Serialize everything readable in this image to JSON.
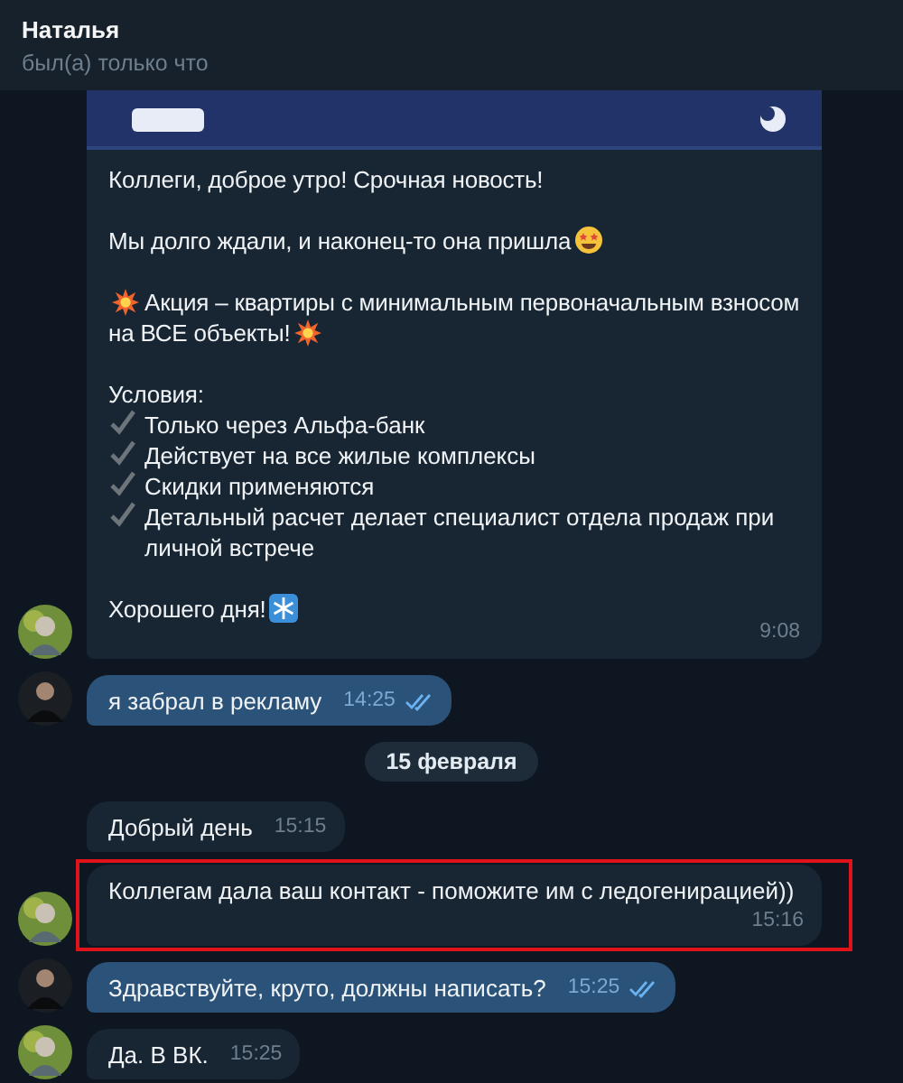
{
  "header": {
    "name": "Наталья",
    "status": "был(а) только что"
  },
  "messages": [
    {
      "kind": "incoming",
      "avatar": true,
      "highlighted": false,
      "time": "9:08",
      "blocks": [
        {
          "kind": "picture"
        },
        {
          "kind": "line",
          "parts": [
            {
              "kind": "text",
              "text": "Коллеги, доброе утро! Срочная новость!"
            }
          ]
        },
        {
          "kind": "gap"
        },
        {
          "kind": "line",
          "parts": [
            {
              "kind": "text",
              "text": "Мы долго ждали, и наконец-то она пришла"
            },
            {
              "kind": "starface"
            }
          ]
        },
        {
          "kind": "gap"
        },
        {
          "kind": "line",
          "parts": [
            {
              "kind": "burst"
            },
            {
              "kind": "text",
              "text": "Акция – квартиры с минимальным первоначальным взносом"
            }
          ]
        },
        {
          "kind": "line",
          "parts": [
            {
              "kind": "text",
              "text": "на ВСЕ объекты!"
            },
            {
              "kind": "burst"
            }
          ]
        },
        {
          "kind": "gap"
        },
        {
          "kind": "line",
          "parts": [
            {
              "kind": "text",
              "text": "Условия:"
            }
          ]
        },
        {
          "kind": "check",
          "text": "Только через Альфа-банк"
        },
        {
          "kind": "check",
          "text": "Действует на все жилые комплексы"
        },
        {
          "kind": "check",
          "text": "Скидки применяются"
        },
        {
          "kind": "check",
          "text": "Детальный расчет делает специалист отдела продаж при личной встрече"
        },
        {
          "kind": "gap"
        },
        {
          "kind": "line",
          "parts": [
            {
              "kind": "text",
              "text": "Хорошего дня!"
            },
            {
              "kind": "snowflake"
            }
          ]
        }
      ]
    },
    {
      "kind": "outgoing",
      "avatar": true,
      "highlighted": false,
      "read": true,
      "time": "14:25",
      "text": "я забрал в рекламу"
    },
    {
      "kind": "date",
      "text": "15 февраля"
    },
    {
      "kind": "incoming",
      "avatar": false,
      "highlighted": false,
      "time": "15:15",
      "text": "Добрый день"
    },
    {
      "kind": "incoming",
      "avatar": true,
      "highlighted": true,
      "time": "15:16",
      "text": "Коллегам дала ваш контакт - поможите им с ледогенирацией))"
    },
    {
      "kind": "outgoing",
      "avatar": true,
      "highlighted": false,
      "read": true,
      "time": "15:25",
      "text": "Здравствуйте, круто, должны написать?"
    },
    {
      "kind": "incoming",
      "avatar": true,
      "highlighted": false,
      "time": "15:25",
      "text": "Да. В ВК."
    }
  ]
}
